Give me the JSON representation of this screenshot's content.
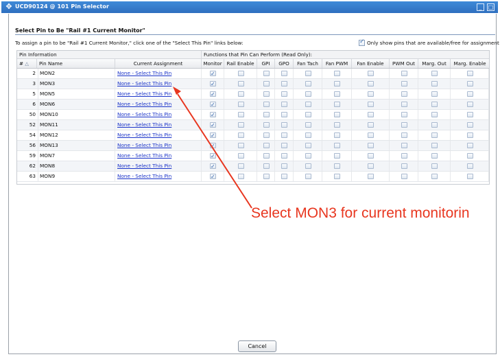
{
  "window": {
    "title": "UCD90124 @ 101 Pin Selector",
    "minimize_glyph": "_",
    "maximize_glyph": "□"
  },
  "section": {
    "title": "Select Pin to Be \"Rail #1 Current Monitor\"",
    "instructions": "To assign a pin to be \"Rail #1 Current Monitor,\" click one of the \"Select This Pin\" links below:",
    "filter_label": "Only show pins that are available/free for assignment",
    "filter_checked": true
  },
  "table": {
    "group_headers": {
      "pin_info": "Pin Information",
      "functions": "Functions that Pin Can Perform (Read Only):"
    },
    "columns": {
      "num": "#",
      "sort_glyph": "△",
      "pin_name": "Pin Name",
      "assignment": "Current Assignment",
      "monitor": "Monitor",
      "rail_enable": "Rail Enable",
      "gpi": "GPI",
      "gpo": "GPO",
      "fan_tach": "Fan Tach",
      "fan_pwm": "Fan PWM",
      "fan_enable": "Fan Enable",
      "pwm_out": "PWM Out",
      "marg_out": "Marg. Out",
      "marg_enable": "Marg. Enable"
    },
    "rows": [
      {
        "num": "2",
        "name": "MON2",
        "assignment": "None - Select This Pin",
        "functions": [
          true,
          false,
          false,
          false,
          false,
          false,
          false,
          false,
          false,
          false
        ]
      },
      {
        "num": "3",
        "name": "MON3",
        "assignment": "None - Select This Pin",
        "functions": [
          true,
          false,
          false,
          false,
          false,
          false,
          false,
          false,
          false,
          false
        ]
      },
      {
        "num": "5",
        "name": "MON5",
        "assignment": "None - Select This Pin",
        "functions": [
          true,
          false,
          false,
          false,
          false,
          false,
          false,
          false,
          false,
          false
        ]
      },
      {
        "num": "6",
        "name": "MON6",
        "assignment": "None - Select This Pin",
        "functions": [
          true,
          false,
          false,
          false,
          false,
          false,
          false,
          false,
          false,
          false
        ]
      },
      {
        "num": "50",
        "name": "MON10",
        "assignment": "None - Select This Pin",
        "functions": [
          true,
          false,
          false,
          false,
          false,
          false,
          false,
          false,
          false,
          false
        ]
      },
      {
        "num": "52",
        "name": "MON11",
        "assignment": "None - Select This Pin",
        "functions": [
          true,
          false,
          false,
          false,
          false,
          false,
          false,
          false,
          false,
          false
        ]
      },
      {
        "num": "54",
        "name": "MON12",
        "assignment": "None - Select This Pin",
        "functions": [
          true,
          false,
          false,
          false,
          false,
          false,
          false,
          false,
          false,
          false
        ]
      },
      {
        "num": "56",
        "name": "MON13",
        "assignment": "None - Select This Pin",
        "functions": [
          true,
          false,
          false,
          false,
          false,
          false,
          false,
          false,
          false,
          false
        ]
      },
      {
        "num": "59",
        "name": "MON7",
        "assignment": "None - Select This Pin",
        "functions": [
          true,
          false,
          false,
          false,
          false,
          false,
          false,
          false,
          false,
          false
        ]
      },
      {
        "num": "62",
        "name": "MON8",
        "assignment": "None - Select This Pin",
        "functions": [
          true,
          false,
          false,
          false,
          false,
          false,
          false,
          false,
          false,
          false
        ]
      },
      {
        "num": "63",
        "name": "MON9",
        "assignment": "None - Select This Pin",
        "functions": [
          true,
          false,
          false,
          false,
          false,
          false,
          false,
          false,
          false,
          false
        ]
      }
    ]
  },
  "annotation": {
    "text": "Select MON3 for current monitorin",
    "color": "#e8361f"
  },
  "footer": {
    "cancel_label": "Cancel"
  },
  "colors": {
    "titlebar": "#3f8ad8",
    "link": "#1a33c8",
    "row_alt": "#f3f5f8"
  }
}
